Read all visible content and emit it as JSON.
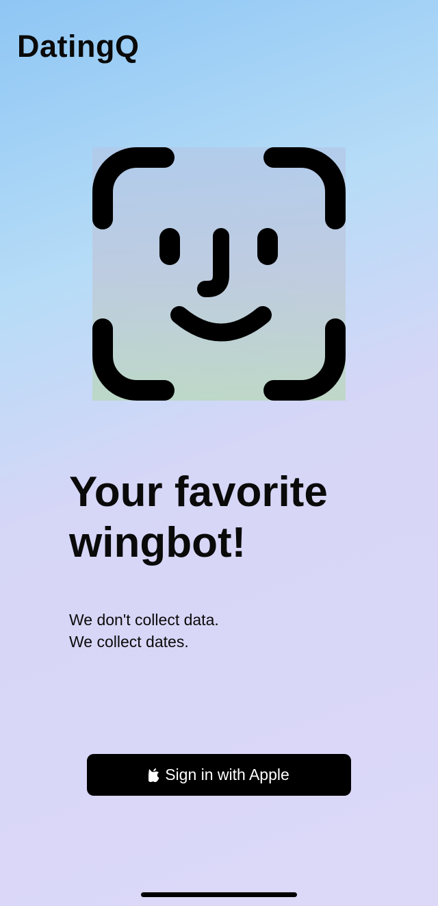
{
  "app": {
    "title": "DatingQ"
  },
  "hero": {
    "icon": "face-id-icon",
    "headline_line1": "Your favorite",
    "headline_line2": "wingbot!"
  },
  "tagline": {
    "line1": "We don't collect data.",
    "line2": "We collect dates."
  },
  "signin": {
    "label": "Sign in with Apple",
    "icon": "apple-logo-icon"
  },
  "colors": {
    "button": "#000000",
    "button_text": "#ffffff",
    "gradient_top": "#8ec6f4",
    "gradient_bottom": "#dcd8f8"
  }
}
